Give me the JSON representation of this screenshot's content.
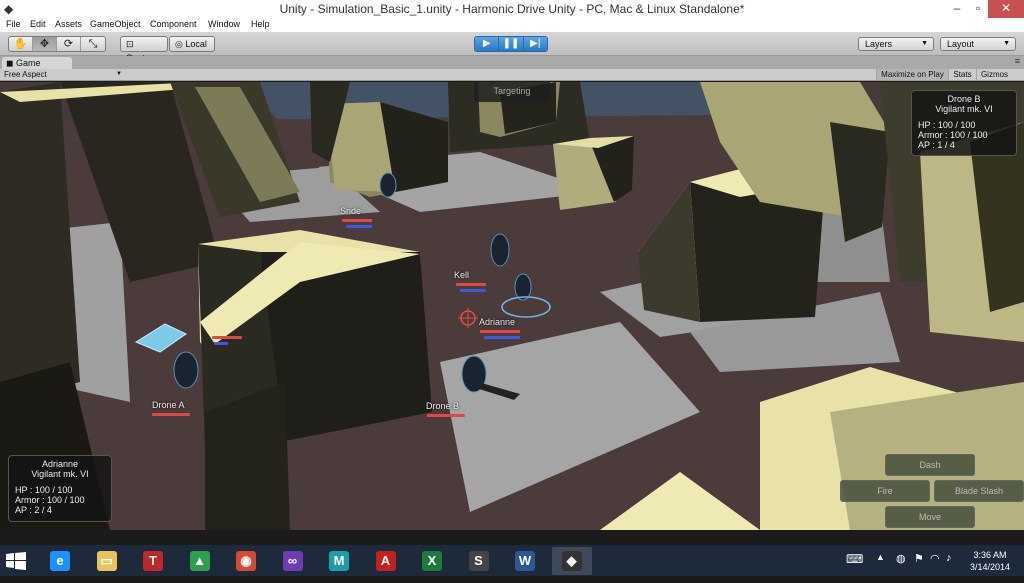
{
  "window": {
    "title": "Unity - Simulation_Basic_1.unity - Harmonic Drive Unity - PC, Mac & Linux Standalone*",
    "app_icon": "unity-icon",
    "minimize": "–",
    "maximize": "▫",
    "close": "✕"
  },
  "menu": [
    "File",
    "Edit",
    "Assets",
    "GameObject",
    "Component",
    "Window",
    "Help"
  ],
  "toolbar": {
    "tools": [
      {
        "name": "hand-tool-icon",
        "glyph": "✋"
      },
      {
        "name": "move-tool-icon",
        "glyph": "✥"
      },
      {
        "name": "rotate-tool-icon",
        "glyph": "⟳"
      },
      {
        "name": "scale-tool-icon",
        "glyph": "⤡"
      }
    ],
    "pivot_label": "Center",
    "space_label": "Local",
    "play": {
      "play_glyph": "▶",
      "pause_glyph": "❚❚",
      "step_glyph": "▶|"
    },
    "layers_label": "Layers",
    "layout_label": "Layout"
  },
  "game_panel": {
    "tab_label": "Game",
    "aspect_label": "Free Aspect",
    "maximize_label": "Maximize on Play",
    "stats_label": "Stats",
    "gizmos_label": "Gizmos"
  },
  "hud": {
    "targeting_label": "Targeting",
    "target_card": {
      "name": "Drone B",
      "class": "Vigilant mk. VI",
      "hp": "HP : 100 / 100",
      "armor": "Armor : 100 / 100",
      "ap": "AP : 1 / 4"
    },
    "selected_card": {
      "name": "Adrianne",
      "class": "Vigilant mk. VI",
      "hp": "HP : 100 / 100",
      "armor": "Armor : 100 / 100",
      "ap": "AP : 2 / 4"
    },
    "actions": {
      "dash": "Dash",
      "fire": "Fire",
      "blade_slash": "Blade Slash",
      "move": "Move"
    },
    "units": [
      {
        "name": "Sride"
      },
      {
        "name": "Kell"
      },
      {
        "name": "Adrianne"
      },
      {
        "name": "Drone A"
      },
      {
        "name": "Drone B"
      }
    ]
  },
  "taskbar": {
    "apps": [
      {
        "name": "internet-explorer-icon",
        "glyph": "e",
        "color": "#1e90ff"
      },
      {
        "name": "file-explorer-icon",
        "glyph": "▭",
        "color": "#e8c25a"
      },
      {
        "name": "app-t-icon",
        "glyph": "T",
        "color": "#c0262d"
      },
      {
        "name": "google-drive-icon",
        "glyph": "▲",
        "color": "#2e9e4f"
      },
      {
        "name": "chrome-icon",
        "glyph": "◉",
        "color": "#d64a34"
      },
      {
        "name": "visual-studio-icon",
        "glyph": "∞",
        "color": "#6e3bb0"
      },
      {
        "name": "maya-icon",
        "glyph": "M",
        "color": "#1b9ea8"
      },
      {
        "name": "acrobat-icon",
        "glyph": "A",
        "color": "#c0231f"
      },
      {
        "name": "excel-icon",
        "glyph": "X",
        "color": "#1e7a3c"
      },
      {
        "name": "sublime-icon",
        "glyph": "S",
        "color": "#444444"
      },
      {
        "name": "word-icon",
        "glyph": "W",
        "color": "#2b5797"
      },
      {
        "name": "unity-taskbar-icon",
        "glyph": "◆",
        "color": "#333333"
      }
    ],
    "time": "3:36 AM",
    "date": "3/14/2014"
  }
}
